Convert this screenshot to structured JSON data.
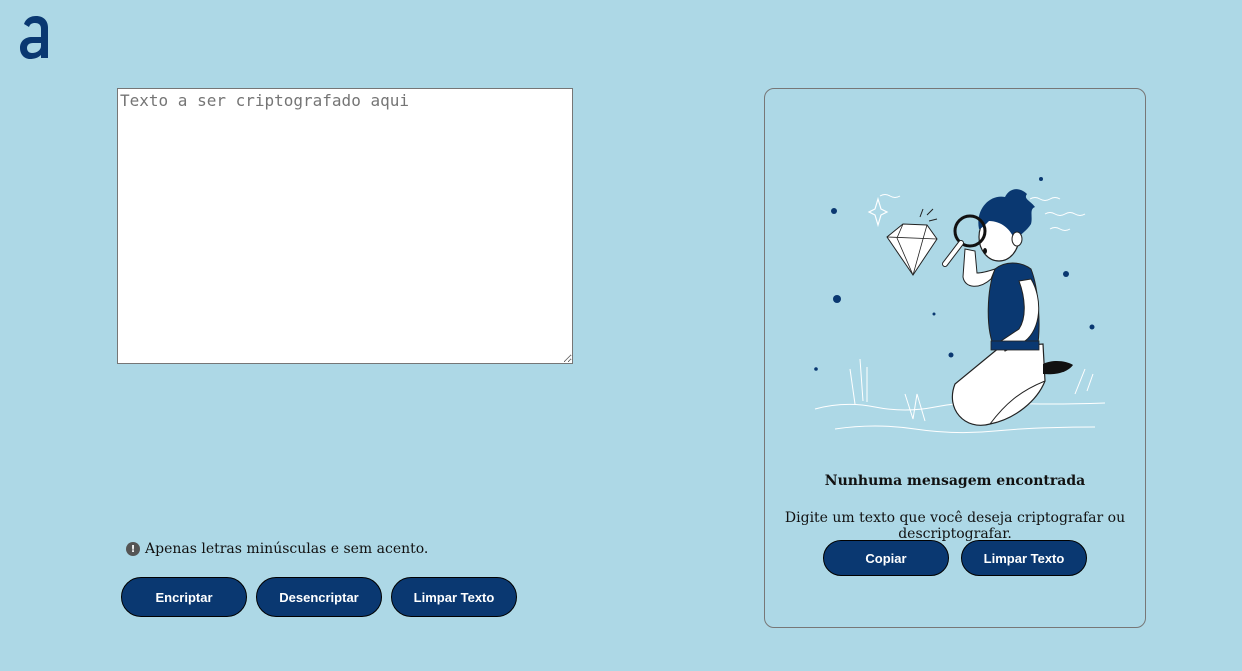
{
  "logo": {
    "icon": "alura-logo-icon",
    "color": "#0a3871"
  },
  "input": {
    "placeholder": "Texto a ser criptografado aqui",
    "value": ""
  },
  "warning": {
    "icon": "exclamation-circle-icon",
    "text": "Apenas letras minúsculas e sem acento."
  },
  "actions": {
    "encrypt_label": "Encriptar",
    "decrypt_label": "Desencriptar",
    "clear_label": "Limpar Texto"
  },
  "output": {
    "illustration": "person-with-magnifying-glass-and-diamond-illustration",
    "title": "Nunhuma mensagem encontrada",
    "subtitle": "Digite um texto que você deseja criptografar ou descriptografar.",
    "copy_label": "Copiar",
    "clear_label": "Limpar Texto"
  },
  "colors": {
    "background": "#add8e6",
    "button": "#0a3871",
    "button_text": "#ffffff"
  }
}
